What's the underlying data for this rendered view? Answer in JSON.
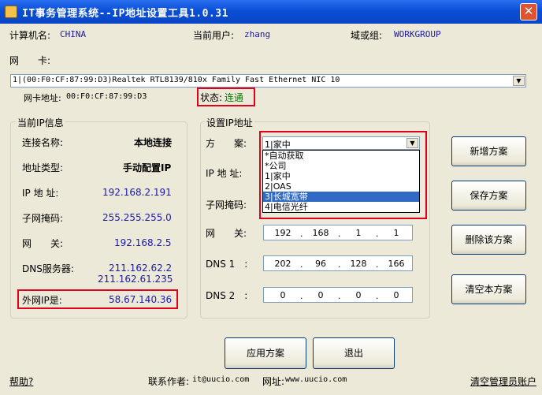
{
  "window": {
    "title": "IT事务管理系统--IP地址设置工具1.0.31",
    "close": "✕"
  },
  "info": {
    "computer_label": "计算机名:",
    "computer_value": "CHINA",
    "user_label": "当前用户:",
    "user_value": "zhang",
    "domain_label": "域或组:",
    "domain_value": "WORKGROUP"
  },
  "nic": {
    "label": "网　　卡:",
    "selected": "1|(00:F0:CF:87:99:D3)Realtek RTL8139/810x Family Fast Ethernet NIC 10",
    "mac_label": "网卡地址:",
    "mac_value": "00:F0:CF:87:99:D3",
    "status_label": "状态:",
    "status_value": "连通"
  },
  "current_ip": {
    "group_title": "当前IP信息",
    "conn_label": "连接名称:",
    "conn_value": "本地连接",
    "type_label": "地址类型:",
    "type_value": "手动配置IP",
    "ip_label": "IP 地 址:",
    "ip_value": "192.168.2.191",
    "mask_label": "子网掩码:",
    "mask_value": "255.255.255.0",
    "gw_label": "网　　关:",
    "gw_value": "192.168.2.5",
    "dns_label": "DNS服务器:",
    "dns_value1": "211.162.62.2",
    "dns_value2": "211.162.61.235",
    "wan_label": "外网IP是:",
    "wan_value": "58.67.140.36"
  },
  "set_ip": {
    "group_title": "设置IP地址",
    "plan_label": "方　　案:",
    "plan_selected": "1|家中",
    "plan_options": [
      "*自动获取",
      "*公司",
      "1|家中",
      "2|OAS",
      "3|长城宽带",
      "4|电信光纤"
    ],
    "plan_highlight_index": 4,
    "ip_label": "IP 地 址:",
    "mask_label": "子网掩码:",
    "gw_label": "网　　关:",
    "gw": [
      "192",
      "168",
      "1",
      "1"
    ],
    "dns1_label": "DNS 1　:",
    "dns1": [
      "202",
      "96",
      "128",
      "166"
    ],
    "dns2_label": "DNS 2　:",
    "dns2": [
      "0",
      "0",
      "0",
      "0"
    ]
  },
  "buttons": {
    "add": "新增方案",
    "save": "保存方案",
    "delete": "删除该方案",
    "clear": "清空本方案",
    "apply": "应用方案",
    "exit": "退出"
  },
  "footer": {
    "help": "帮助?",
    "author_label": "联系作者:",
    "author_value": "it@uucio.com",
    "site_label": "网址:",
    "site_value": "www.uucio.com",
    "clear_admin": "清空管理员账户"
  },
  "colors": {
    "titlebar": "#0a4fd8",
    "highlight_box": "#e0001b",
    "value_blue": "#1a1aa8",
    "status_green": "#008000",
    "selection": "#316ac5"
  }
}
